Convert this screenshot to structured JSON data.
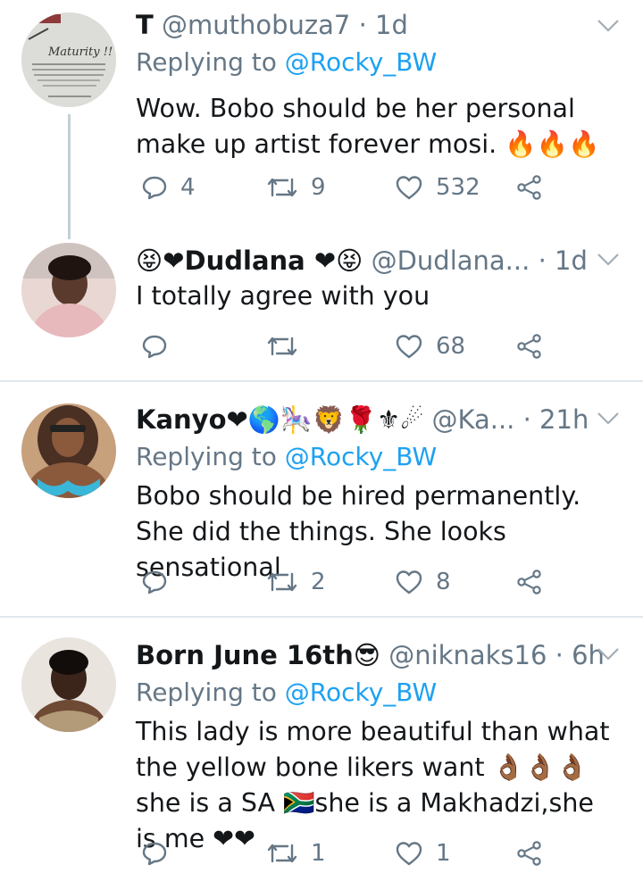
{
  "colors": {
    "text": "#14171a",
    "secondary": "#657786",
    "link": "#1da1f2",
    "divider": "#e1e8ed",
    "thread_line": "#c4cfd6",
    "emoji_red": "#e0245e"
  },
  "tweets": [
    {
      "name": "T",
      "handle": "@muthobuza7",
      "time": "· 1d",
      "replying_prefix": "Replying to ",
      "replying_to": "@Rocky_BW",
      "text": "Wow. Bobo should be her personal make up artist forever mosi. 🔥🔥🔥",
      "replies": "4",
      "retweets": "9",
      "likes": "532",
      "avatar_text": "Maturity !!"
    },
    {
      "name": "😝❤Dudlana ❤😝",
      "handle": "@Dudlana...",
      "time": "· 1d",
      "text": "I totally agree with you",
      "replies": "",
      "retweets": "",
      "likes": "68"
    },
    {
      "name": "Kanyo❤🌎🎠🦁🌹⚜☄",
      "handle": "@Ka...",
      "time": "· 21h",
      "replying_prefix": "Replying to ",
      "replying_to": "@Rocky_BW",
      "text": "Bobo should be hired permanently. She did the things. She looks sensational",
      "replies": "",
      "retweets": "2",
      "likes": "8"
    },
    {
      "name": "Born June 16th😎",
      "handle": "@niknaks16",
      "time": "· 6h",
      "replying_prefix": "Replying to ",
      "replying_to": "@Rocky_BW",
      "text": "This lady is more beautiful than what the yellow bone likers want 👌🏾👌🏾👌🏾she is a SA 🇿🇦she is a Makhadzi,she is me ❤❤",
      "replies": "",
      "retweets": "1",
      "likes": "1"
    }
  ],
  "icons": {
    "reply": "reply-icon",
    "retweet": "retweet-icon",
    "like": "heart-icon",
    "share": "share-icon",
    "more": "chevron-down-icon"
  }
}
